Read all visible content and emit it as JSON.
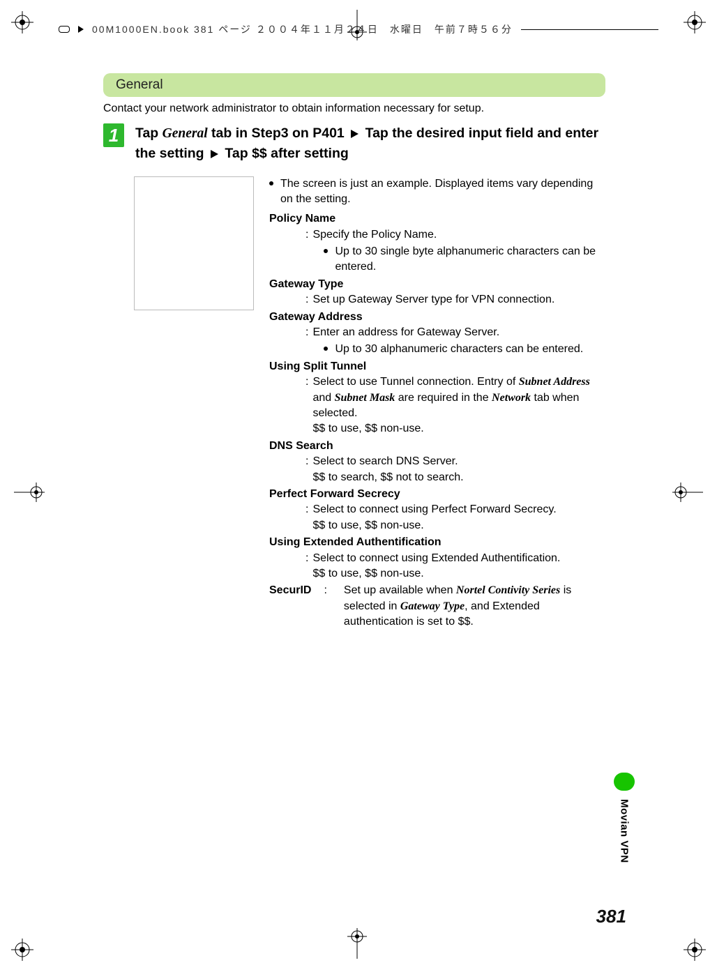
{
  "header": {
    "text": "00M1000EN.book  381 ページ  ２００４年１１月２４日　水曜日　午前７時５６分"
  },
  "section": {
    "heading": "General",
    "intro": "Contact your network administrator to obtain information necessary for setup."
  },
  "step": {
    "number": "1",
    "pre": "Tap ",
    "general": "General",
    "mid1": " tab in Step3 on P401 ",
    "mid2": " Tap the desired input field and enter the setting ",
    "post": " Tap $$ after setting"
  },
  "firstBullet": "The screen is just an example. Displayed items vary depending on the setting.",
  "defs": {
    "policy": {
      "term": "Policy Name",
      "desc": "Specify the Policy Name.",
      "sub": "Up to 30 single byte alphanumeric characters can be entered."
    },
    "gwType": {
      "term": "Gateway Type",
      "desc": "Set up Gateway Server type for VPN connection."
    },
    "gwAddr": {
      "term": "Gateway Address",
      "desc": "Enter an address for Gateway Server.",
      "sub": "Up to 30 alphanumeric characters can be entered."
    },
    "split": {
      "term": "Using Split Tunnel",
      "descPre": "Select to use Tunnel connection. Entry of ",
      "subnetAddr": "Subnet Address",
      "descMid": " and ",
      "subnetMask": "Subnet Mask",
      "descMid2": " are required in the ",
      "network": "Network",
      "descPost": " tab when selected.",
      "line2": "$$ to use, $$ non-use."
    },
    "dns": {
      "term": "DNS Search",
      "desc": "Select to search DNS Server.",
      "line2": "$$ to search, $$ not to search."
    },
    "pfs": {
      "term": "Perfect Forward Secrecy",
      "desc": "Select to connect using Perfect Forward Secrecy.",
      "line2": "$$ to use, $$ non-use."
    },
    "xauth": {
      "term": "Using Extended Authentification",
      "desc": "Select to connect using Extended Authentification.",
      "line2": "$$ to use, $$ non-use."
    },
    "securid": {
      "term": "SecurID",
      "descPre": "Set up available when ",
      "nortel": "Nortel Contivity Series",
      "descMid": " is selected in ",
      "gwType": "Gateway Type",
      "descPost": ", and Extended authentication is set to $$."
    }
  },
  "sideTab": "Movian VPN",
  "pageNumber": "381"
}
